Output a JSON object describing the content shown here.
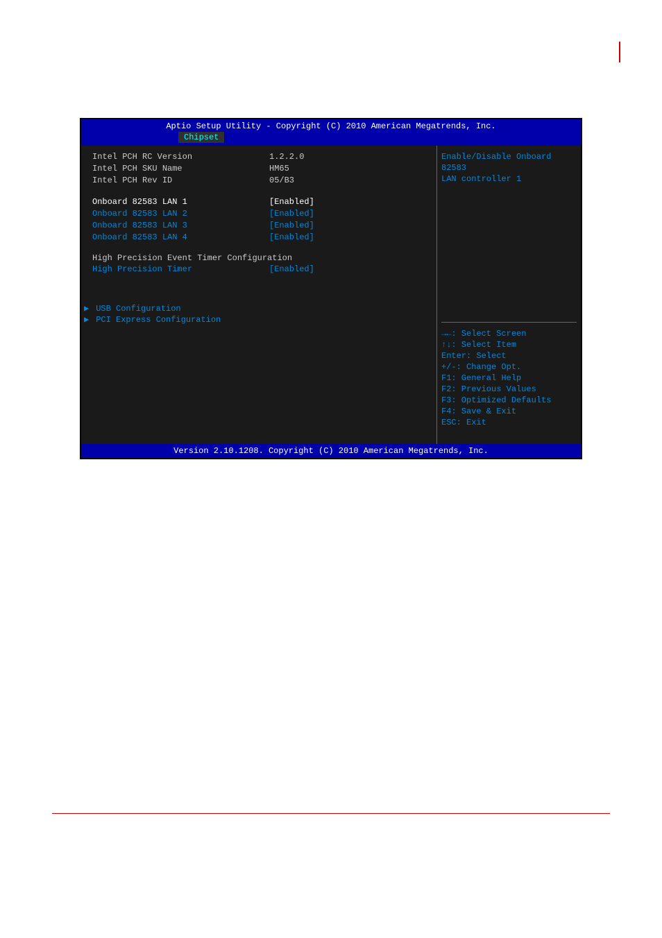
{
  "header": {
    "title": "Aptio Setup Utility - Copyright (C) 2010 American Megatrends, Inc.",
    "active_tab": "Chipset"
  },
  "info_rows": [
    {
      "label": "Intel PCH RC Version",
      "value": "1.2.2.0"
    },
    {
      "label": "Intel PCH SKU Name",
      "value": "HM65"
    },
    {
      "label": "Intel PCH Rev ID",
      "value": "05/B3"
    }
  ],
  "lan_settings": [
    {
      "label": "Onboard 82583 LAN 1",
      "value": "[Enabled]",
      "selected": true
    },
    {
      "label": "Onboard 82583 LAN 2",
      "value": "[Enabled]",
      "selected": false
    },
    {
      "label": "Onboard 82583 LAN 3",
      "value": "[Enabled]",
      "selected": false
    },
    {
      "label": "Onboard 82583 LAN 4",
      "value": "[Enabled]",
      "selected": false
    }
  ],
  "hpet": {
    "section_label": "High Precision Event Timer Configuration",
    "setting_label": "High Precision Timer",
    "setting_value": "[Enabled]"
  },
  "submenus": [
    {
      "label": "USB Configuration"
    },
    {
      "label": "PCI Express Configuration"
    }
  ],
  "help": {
    "line1": "Enable/Disable Onboard 82583",
    "line2": "LAN controller 1"
  },
  "nav_help": [
    "→←: Select Screen",
    "↑↓: Select Item",
    "Enter: Select",
    "+/-: Change Opt.",
    "F1: General Help",
    "F2: Previous Values",
    "F3: Optimized Defaults",
    "F4: Save & Exit",
    "ESC: Exit"
  ],
  "footer": "Version 2.10.1208. Copyright (C) 2010 American Megatrends, Inc."
}
